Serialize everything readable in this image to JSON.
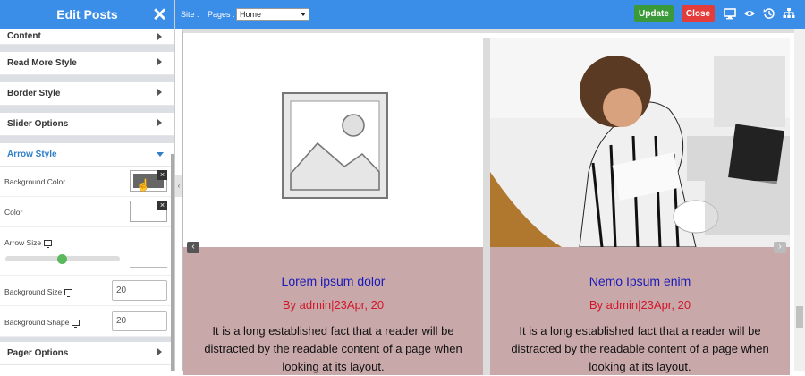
{
  "sidebar": {
    "title": "Edit Posts",
    "sections": {
      "content": "Content",
      "read_more": "Read More Style",
      "border": "Border Style",
      "slider": "Slider Options",
      "arrow": "Arrow Style",
      "pager": "Pager Options"
    },
    "arrow_fields": {
      "background_color": {
        "label": "Background Color",
        "value_color": "#666666"
      },
      "color": {
        "label": "Color",
        "value_color": "#ffffff"
      },
      "arrow_size": {
        "label": "Arrow Size",
        "value": 0.5
      },
      "background_size": {
        "label": "Background Size",
        "value": "20"
      },
      "background_shape": {
        "label": "Background Shape",
        "value": "20"
      }
    }
  },
  "topbar": {
    "site_label": "Site :",
    "pages_label": "Pages :",
    "page_selected": "Home",
    "update_label": "Update",
    "close_label": "Close",
    "icons": [
      "desktop-icon",
      "eye-icon",
      "history-icon",
      "sitemap-icon"
    ]
  },
  "cards": [
    {
      "title": "Lorem ipsum dolor",
      "byline": "By admin|23Apr, 20",
      "text": "It is a long established fact that a reader will be distracted by the readable content of a page when looking at its layout."
    },
    {
      "title": "Nemo Ipsum enim",
      "byline": "By admin|23Apr, 20",
      "text": "It is a long established fact that a reader will be distracted by the readable content of a page when looking at its layout."
    }
  ],
  "colors": {
    "header_blue": "#3b8ee8",
    "update_green": "#3a9a3a",
    "close_red": "#e43b3b",
    "card_body": "#c9a8aa",
    "title_blue": "#1a1ab8",
    "byline_red": "#d0172a"
  }
}
